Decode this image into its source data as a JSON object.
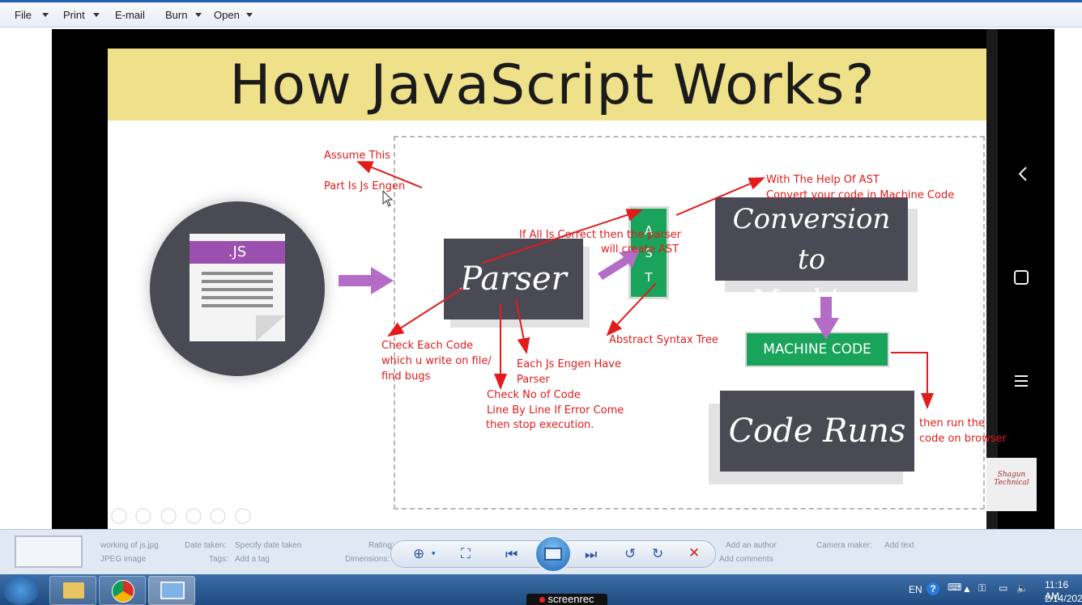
{
  "toolbar": {
    "file": "File",
    "print": "Print",
    "email": "E-mail",
    "burn": "Burn",
    "open": "Open"
  },
  "slide": {
    "title": "How JavaScript Works?",
    "js_label": ".JS",
    "parser": "Parser",
    "ast_letters": [
      "A",
      "S",
      "T"
    ],
    "conversion_line1": "Conversion to",
    "conversion_line2": "Machine code",
    "machine_code": "MACHINE CODE",
    "code_runs": "Code Runs",
    "logo_line1": "Shagun",
    "logo_line2": "Technical"
  },
  "annotations": {
    "assume_this": "Assume This",
    "part_is_js": "Part Is Js Engen",
    "with_help_line1": "With The Help Of AST",
    "with_help_line2": "Convert your code in Machine Code",
    "if_all_line1": "If All Is Correct  then the parser",
    "if_all_line2": "will create AST",
    "check_each_line1": "Check Each Code",
    "check_each_line2": "which u write on file/",
    "check_each_line3": "find bugs",
    "each_js_line1": "Each Js Engen Have",
    "each_js_line2": "Parser",
    "check_no_line1": "Check No of Code",
    "check_no_line2": "Line By Line  If Error Come",
    "check_no_line3": "then stop execution.",
    "abstract": "Abstract Syntax Tree",
    "then_run_line1": "then run the",
    "then_run_line2": "code on browser"
  },
  "infobar": {
    "filename": "working of js.jpg",
    "filetype": "JPEG image",
    "date_label": "Date taken:",
    "date_value": "Specify date taken",
    "tags_label": "Tags:",
    "tags_value": "Add a tag",
    "rating_label": "Rating:",
    "dimensions_label": "Dimensions:",
    "authors_value": "Add an author",
    "comments_value": "Add comments",
    "camera_label": "Camera maker:",
    "camera_value": "Add text"
  },
  "taskbar": {
    "lang": "EN",
    "time": "11:16 AM",
    "date": "2/14/202",
    "screenrec": "screenrec"
  },
  "colors": {
    "annotation_red": "#e21b1b",
    "title_band": "#efe08a",
    "dark_box": "#4a4a55",
    "green": "#1aa35a",
    "purple": "#9b4fae"
  }
}
